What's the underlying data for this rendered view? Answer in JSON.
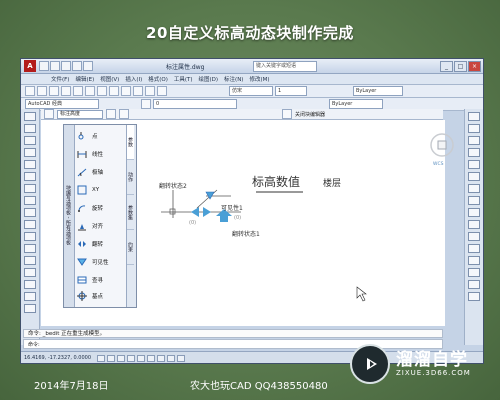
{
  "slide": {
    "title": "20自定义标高动态块制作完成",
    "date": "2014年7月18日",
    "author": "农大也玩CAD  QQ438550480",
    "watermark_big": "溜溜自学",
    "watermark_small": "ZIXUE.3D66.COM"
  },
  "app": {
    "logo": "A",
    "title": "标注属性.dwg",
    "search_placeholder": "键入关键字或短语",
    "menus": [
      "文件(F)",
      "编辑(E)",
      "视图(V)",
      "插入(I)",
      "格式(O)",
      "工具(T)",
      "绘图(D)",
      "标注(N)",
      "修改(M)"
    ],
    "workspace": "AutoCAD 经典",
    "layer_value": "0",
    "linetype": "ByLayer",
    "lineweight": "ByLayer",
    "style": "仿宋",
    "scale": "1",
    "editor_block": "标注高度",
    "close_editor": "关闭块编辑器",
    "command_history": "命令: _bedit 正在重生成模型。",
    "command_prompt": "命令:",
    "coords": "16.4169, -17.2327, 0.0000"
  },
  "palette": {
    "side_label": "块编写选项板 - 所有选项板",
    "tabs": [
      "参数",
      "动作",
      "参数集",
      "约束"
    ],
    "items": [
      "点",
      "线性",
      "极轴",
      "XY",
      "旋转",
      "对齐",
      "翻转",
      "可见性",
      "查寻",
      "基点"
    ]
  },
  "drawing": {
    "main_text": "标高数值",
    "floor_text": "楼层",
    "flip1": "翻转状态2",
    "flip2": "翻转状态1",
    "visibility": "可见性1",
    "tag1": "(0)",
    "tag2": "(0)",
    "compass": "WCS"
  }
}
